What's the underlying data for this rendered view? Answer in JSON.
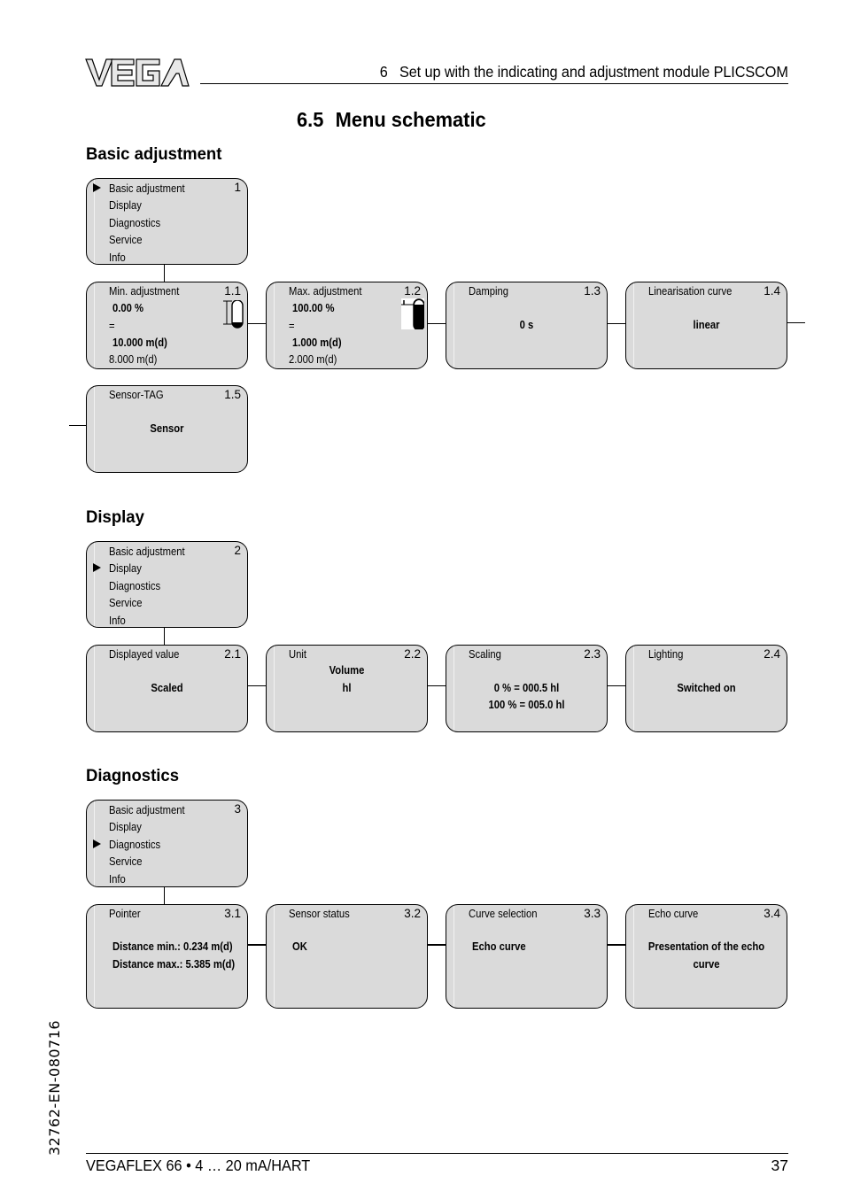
{
  "header": {
    "logo_text": "VEGA",
    "chapter": "6   Set up with the indicating and adjustment module PLICSCOM"
  },
  "page_title": {
    "number": "6.5",
    "text": "Menu schematic"
  },
  "sections": {
    "basic": {
      "heading": "Basic adjustment",
      "main_menu": {
        "index": "1",
        "selected": "Basic adjustment",
        "items": [
          "Basic adjustment",
          "Display",
          "Diagnostics",
          "Service",
          "Info"
        ]
      },
      "boxes": [
        {
          "title": "Min. adjustment",
          "index": "1.1",
          "value_pct": "0.00 %",
          "equals": "=",
          "value_main": "10.000 m(d)",
          "value_sub": "8.000 m(d)",
          "icon": "tank-min-icon"
        },
        {
          "title": "Max. adjustment",
          "index": "1.2",
          "value_pct": "100.00 %",
          "equals": "=",
          "value_main": "1.000 m(d)",
          "value_sub": "2.000 m(d)",
          "icon": "tank-max-icon"
        },
        {
          "title": "Damping",
          "index": "1.3",
          "value": "0 s"
        },
        {
          "title": "Linearisation curve",
          "index": "1.4",
          "value": "linear"
        },
        {
          "title": "Sensor-TAG",
          "index": "1.5",
          "value": "Sensor"
        }
      ]
    },
    "display": {
      "heading": "Display",
      "main_menu": {
        "index": "2",
        "selected": "Display",
        "items": [
          "Basic adjustment",
          "Display",
          "Diagnostics",
          "Service",
          "Info"
        ]
      },
      "boxes": [
        {
          "title": "Displayed value",
          "index": "2.1",
          "value": "Scaled"
        },
        {
          "title": "Unit",
          "index": "2.2",
          "value_line1": "Volume",
          "value_line2": "hl"
        },
        {
          "title": "Scaling",
          "index": "2.3",
          "value_line1": "0 % = 000.5 hl",
          "value_line2": "100 % = 005.0 hl"
        },
        {
          "title": "Lighting",
          "index": "2.4",
          "value": "Switched on"
        }
      ]
    },
    "diagnostics": {
      "heading": "Diagnostics",
      "main_menu": {
        "index": "3",
        "selected": "Diagnostics",
        "items": [
          "Basic adjustment",
          "Display",
          "Diagnostics",
          "Service",
          "Info"
        ]
      },
      "boxes": [
        {
          "title": "Pointer",
          "index": "3.1",
          "value_line1": "Distance min.: 0.234 m(d)",
          "value_line2": "Distance max.: 5.385 m(d)"
        },
        {
          "title": "Sensor status",
          "index": "3.2",
          "value": "OK"
        },
        {
          "title": "Curve selection",
          "index": "3.3",
          "value": "Echo curve"
        },
        {
          "title": "Echo curve",
          "index": "3.4",
          "value_line1": "Presentation of the echo",
          "value_line2": "curve"
        }
      ]
    }
  },
  "footer": {
    "product": "VEGAFLEX 66 • 4 … 20 mA/HART",
    "page_number": "37",
    "doc_code": "32762-EN-080716"
  }
}
